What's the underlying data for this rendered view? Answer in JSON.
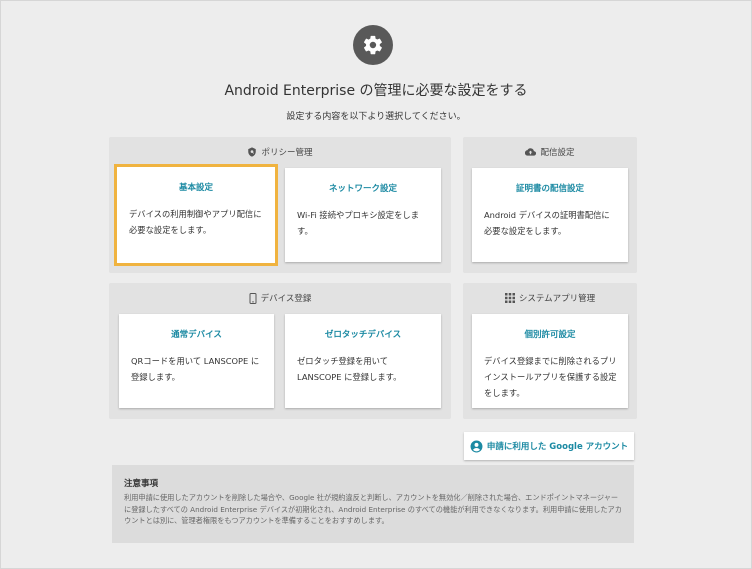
{
  "header": {
    "title": "Android Enterprise の管理に必要な設定をする",
    "subtitle": "設定する内容を以下より選択してください。"
  },
  "sections": {
    "policy": {
      "label": "ポリシー管理",
      "cards": [
        {
          "title": "基本設定",
          "desc": "デバイスの利用制御やアプリ配信に必要な設定をします。"
        },
        {
          "title": "ネットワーク設定",
          "desc": "Wi-Fi 接続やプロキシ設定をします。"
        }
      ]
    },
    "distribution": {
      "label": "配信設定",
      "cards": [
        {
          "title": "証明書の配信設定",
          "desc": "Android デバイスの証明書配信に必要な設定をします。"
        }
      ]
    },
    "device": {
      "label": "デバイス登録",
      "cards": [
        {
          "title": "通常デバイス",
          "desc": "QRコードを用いて LANSCOPE に登録します。"
        },
        {
          "title": "ゼロタッチデバイス",
          "desc": "ゼロタッチ登録を用いて LANSCOPE に登録します。"
        }
      ]
    },
    "system_apps": {
      "label": "システムアプリ管理",
      "cards": [
        {
          "title": "個別許可設定",
          "desc": "デバイス登録までに削除されるプリインストールアプリを保護する設定をします。"
        }
      ]
    }
  },
  "google_account_button": {
    "label": "申請に利用した Google アカウント"
  },
  "notice": {
    "title": "注意事項",
    "body": "利用申請に使用したアカウントを削除した場合や、Google 社が規約違反と判断し、アカウントを無効化／削除された場合、エンドポイントマネージャーに登録したすべての Android Enterprise デバイスが初期化され、Android Enterprise のすべての機能が利用できなくなります。利用申請に使用したアカウントとは別に、管理者権限をもつアカウントを準備することをおすすめします。"
  },
  "colors": {
    "accent": "#1c8aa3",
    "selected_outline": "#f0b33f",
    "gear_bg": "#595959"
  }
}
